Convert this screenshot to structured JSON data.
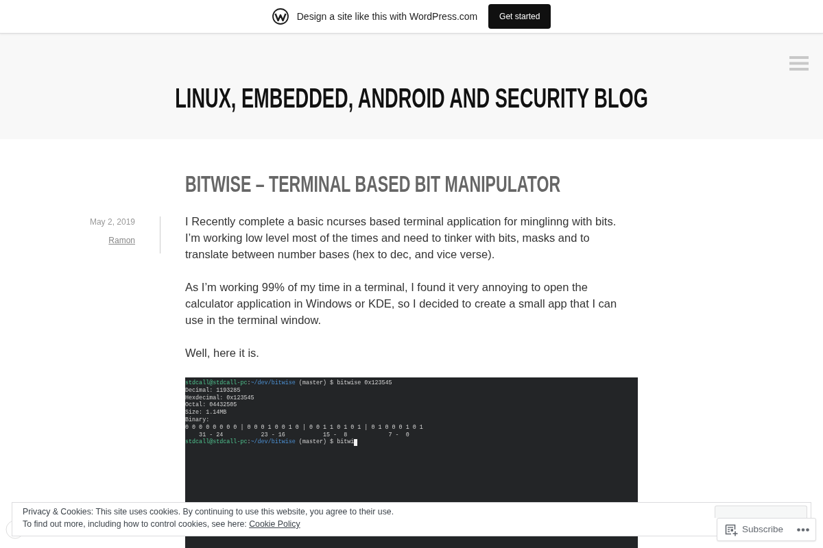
{
  "promo_bar": {
    "text": "Design a site like this with WordPress.com",
    "button": "Get started"
  },
  "header": {
    "site_title": "LINUX, EMBEDDED, ANDROID AND SECURITY BLOG"
  },
  "post": {
    "title": "BITWISE – TERMINAL BASED BIT MANIPULATOR",
    "date": "May 2, 2019",
    "author": "Ramon",
    "paragraphs": [
      "I Recently complete a basic ncurses based terminal application for minglinng with bits. I’m working low level most of the times and need to tinker with bits, masks and to translate between number bases (hex to dec, and vice verse).",
      "As I’m working 99% of my time in a terminal, I found it very annoying to open the calculator application in Windows or KDE, so I decided to create a small app that I can use in the terminal window.",
      "Well, here it is."
    ],
    "terminal": {
      "lines": [
        {
          "segments": [
            {
              "kind": "host",
              "text": "stdcall@stdcall-pc"
            },
            {
              "kind": "plain",
              "text": ":"
            },
            {
              "kind": "path",
              "text": "~/dev/bitwise"
            },
            {
              "kind": "plain",
              "text": " (master) $ bitwise 0x123545"
            }
          ],
          "cursor": false
        },
        {
          "segments": [
            {
              "kind": "plain",
              "text": "Decimal: 1193285"
            }
          ],
          "cursor": false
        },
        {
          "segments": [
            {
              "kind": "plain",
              "text": "Hexdecimal: 0x123545"
            }
          ],
          "cursor": false
        },
        {
          "segments": [
            {
              "kind": "plain",
              "text": "Octal: 04432505"
            }
          ],
          "cursor": false
        },
        {
          "segments": [
            {
              "kind": "plain",
              "text": "Size: 1.14MB"
            }
          ],
          "cursor": false
        },
        {
          "segments": [
            {
              "kind": "plain",
              "text": "Binary:"
            }
          ],
          "cursor": false
        },
        {
          "segments": [
            {
              "kind": "plain",
              "text": "0 0 0 0 0 0 0 0 | 0 0 0 1 0 0 1 0 | 0 0 1 1 0 1 0 1 | 0 1 0 0 0 1 0 1"
            }
          ],
          "cursor": false
        },
        {
          "segments": [
            {
              "kind": "plain",
              "text": "    31 - 24           23 - 16           15 -  8            7 -  0"
            }
          ],
          "cursor": false
        },
        {
          "segments": [
            {
              "kind": "host",
              "text": "stdcall@stdcall-pc"
            },
            {
              "kind": "plain",
              "text": ":"
            },
            {
              "kind": "path",
              "text": "~/dev/bitwise"
            },
            {
              "kind": "plain",
              "text": " (master) $ bitwi"
            }
          ],
          "cursor": true
        }
      ]
    }
  },
  "cookie_banner": {
    "lines": [
      {
        "text": "Privacy & Cookies: This site uses cookies. By continuing to use this website, you agree to their use."
      },
      {
        "text": "To find out more, including how to control cookies, see here:",
        "link": "Cookie Policy"
      }
    ]
  },
  "subscribe_bar": {
    "label": "Subscribe"
  }
}
